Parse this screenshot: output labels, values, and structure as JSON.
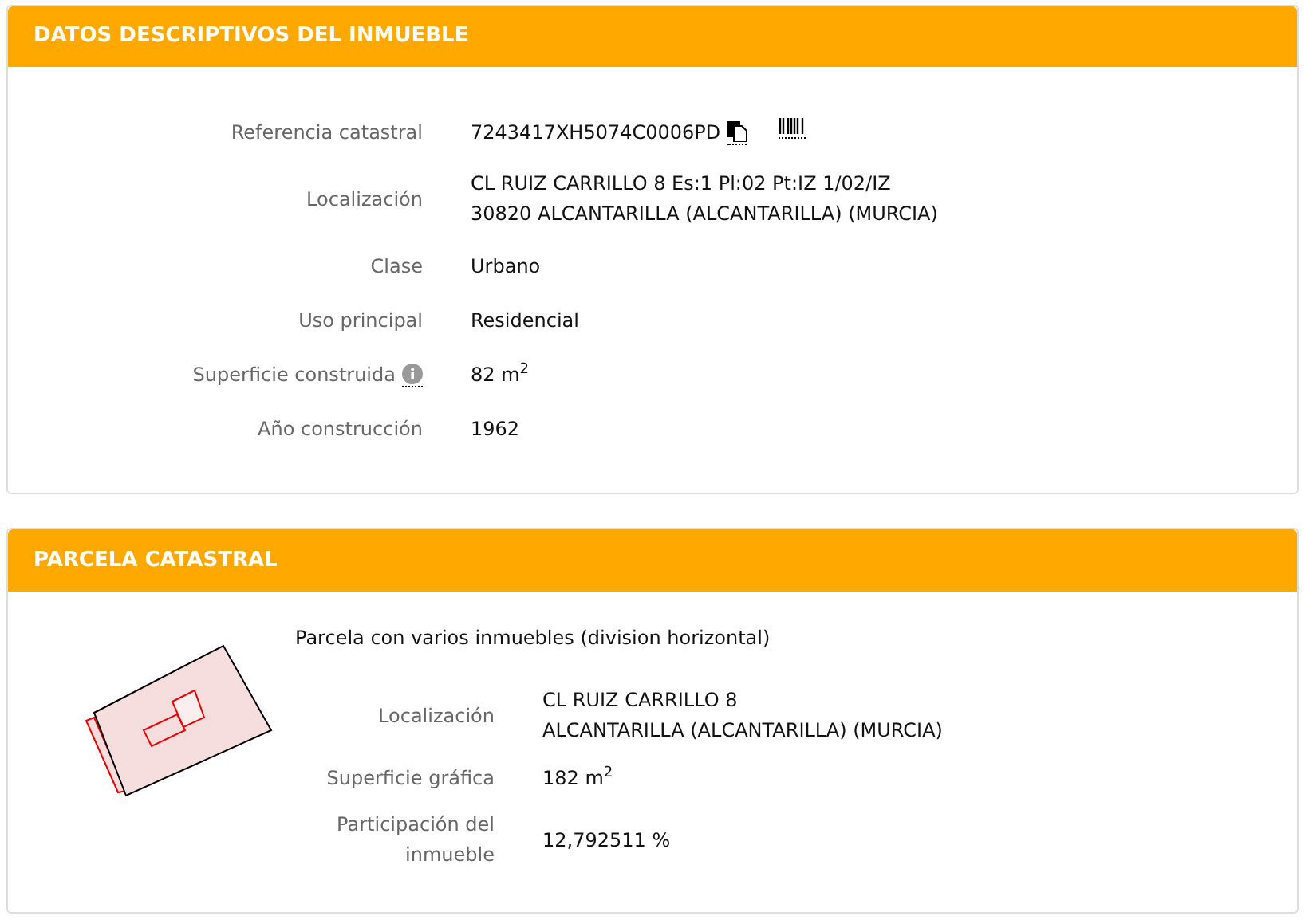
{
  "descriptive": {
    "title": "DATOS DESCRIPTIVOS DEL INMUEBLE",
    "rows": [
      {
        "kind": "reference",
        "label": "Referencia catastral",
        "lines": [
          "7243417XH5074C0006PD"
        ]
      },
      {
        "kind": "plain",
        "label": "Localización",
        "lines": [
          "CL RUIZ CARRILLO 8 Es:1 Pl:02 Pt:IZ 1/02/IZ",
          "30820 ALCANTARILLA (ALCANTARILLA) (MURCIA)"
        ]
      },
      {
        "kind": "plain",
        "label": "Clase",
        "lines": [
          "Urbano"
        ]
      },
      {
        "kind": "plain",
        "label": "Uso principal",
        "lines": [
          "Residencial"
        ]
      },
      {
        "kind": "info",
        "label": "Superficie construida",
        "lines": [
          "82 m$^{2}$"
        ]
      },
      {
        "kind": "plain",
        "label": "Año construcción",
        "lines": [
          "1962"
        ]
      }
    ]
  },
  "parcel": {
    "title": "PARCELA CATASTRAL",
    "subtitle": "Parcela con varios inmuebles (division horizontal)",
    "rows": [
      {
        "label": "Localización",
        "lines": [
          "CL RUIZ CARRILLO 8",
          "ALCANTARILLA (ALCANTARILLA) (MURCIA)"
        ]
      },
      {
        "label": "Superficie gráfica",
        "lines": [
          "182 m$^{2}$"
        ]
      },
      {
        "label": "Participación del inmueble",
        "lines": [
          "12,792511 %"
        ]
      }
    ]
  }
}
